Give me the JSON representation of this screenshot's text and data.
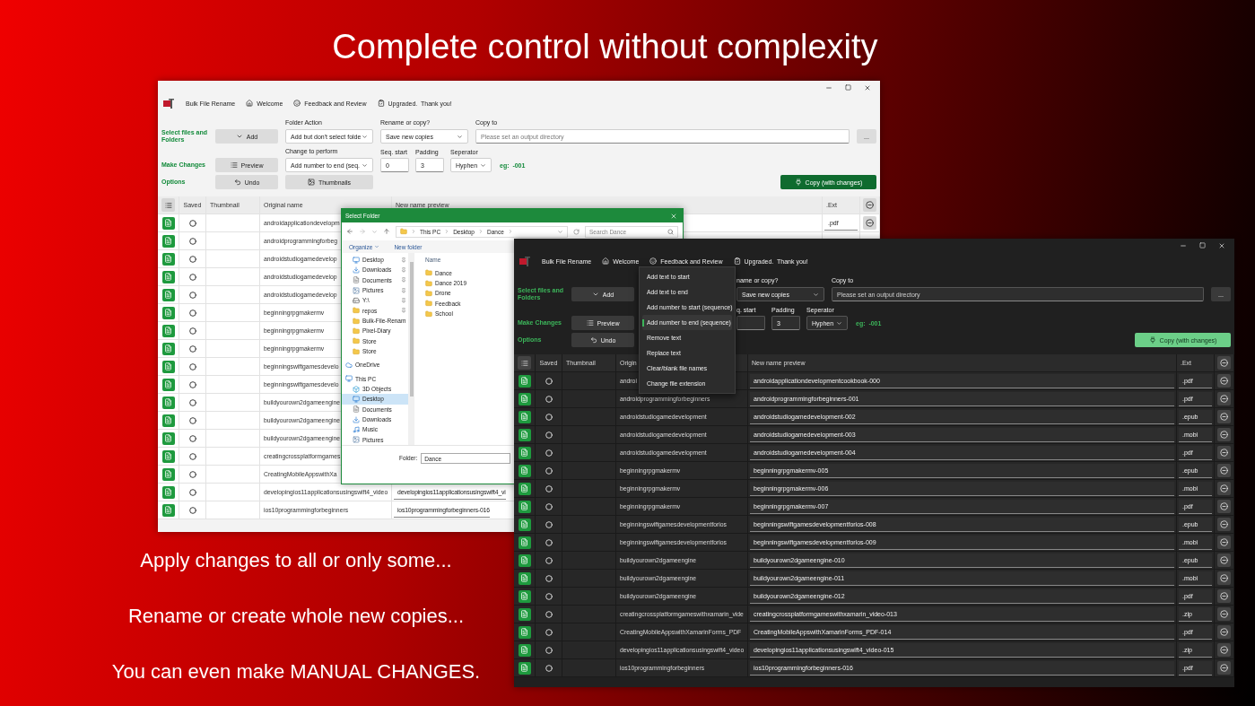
{
  "headline": "Complete control without complexity",
  "taglines": [
    "Apply changes to all or only some...",
    "Rename or create whole new copies...",
    "You can even make MANUAL CHANGES."
  ],
  "app_windows": [
    {
      "kind": "light",
      "nav": {
        "app_name": "Bulk File Rename",
        "links": [
          "Welcome",
          "Feedback and Review",
          "Upgraded.  Thank you!"
        ]
      },
      "section_labels": [
        "Select files and Folders",
        "Make Changes",
        "Options"
      ],
      "buttons": {
        "add": "Add",
        "preview": "Preview",
        "undo": "Undo",
        "thumbnails": "Thumbnails",
        "browse": "...",
        "copy": "Copy (with changes)"
      },
      "folder_action": {
        "label": "Folder Action",
        "value": "Add but don't select folde"
      },
      "change": {
        "label": "Change to perform",
        "value": "Add number to end (seq."
      },
      "rename_or_copy": {
        "label": "Rename or copy?",
        "value": "Save new copies"
      },
      "copy_to": {
        "label": "Copy to",
        "placeholder": "Please set an output directory"
      },
      "seq_start": {
        "label": "Seq. start",
        "value": "0"
      },
      "padding": {
        "label": "Padding",
        "value": "3"
      },
      "separator": {
        "label": "Seperator",
        "value": "Hyphen"
      },
      "example": "eg:  -001",
      "columns": [
        "Saved",
        "Thumbnail",
        "Original name",
        "New name preview",
        ".Ext"
      ],
      "rows": [
        {
          "original": "androidapplicationdevelopm",
          "ext": ".pdf"
        },
        {
          "original": "androidprogrammingforbeg"
        },
        {
          "original": "androidstudiogamedevelop"
        },
        {
          "original": "androidstudiogamedevelop"
        },
        {
          "original": "androidstudiogamedevelop"
        },
        {
          "original": "beginningrpgmakermv"
        },
        {
          "original": "beginningrpgmakermv"
        },
        {
          "original": "beginningrpgmakermv"
        },
        {
          "original": "beginningswiftgamesdevelo"
        },
        {
          "original": "beginningswiftgamesdevelo"
        },
        {
          "original": "buildyourown2dgameengine"
        },
        {
          "original": "buildyourown2dgameengine"
        },
        {
          "original": "buildyourown2dgameengine"
        },
        {
          "original": "creatingcrossplatformgames"
        },
        {
          "original": "CreatingMobileAppswithXa"
        },
        {
          "original": "developingios11applicationsusingswift4_video",
          "new_name": "developingios11applicationsusingswift4_vi"
        },
        {
          "original": "ios10programmingforbeginners",
          "new_name": "ios10programmingforbeginners-016"
        }
      ]
    },
    {
      "kind": "dark",
      "nav": {
        "app_name": "Bulk File Rename",
        "links": [
          "Welcome",
          "Feedback and Review",
          "Upgraded.  Thank you!"
        ]
      },
      "section_labels": [
        "Select files and Folders",
        "Make Changes",
        "Options"
      ],
      "buttons": {
        "add": "Add",
        "preview": "Preview",
        "undo": "Undo",
        "browse": "...",
        "copy": "Copy (with changes)"
      },
      "rename_or_copy": {
        "label": "name or copy?",
        "value": "Save new copies"
      },
      "copy_to": {
        "label": "Copy to",
        "placeholder": "Please set an output directory"
      },
      "seq_start": {
        "label": "q. start"
      },
      "padding": {
        "label": "Padding",
        "value": "3"
      },
      "separator": {
        "label": "Seperator",
        "value": "Hyphen"
      },
      "example": "eg:  -001",
      "menu": {
        "items": [
          {
            "label": "Add text to start",
            "selected": false
          },
          {
            "label": "Add text to end",
            "selected": false
          },
          {
            "label": "Add number to start (sequence)",
            "selected": false
          },
          {
            "label": "Add number to end (sequence)",
            "selected": true
          },
          {
            "label": "Remove text",
            "selected": false
          },
          {
            "label": "Replace text",
            "selected": false
          },
          {
            "label": "Clear/blank file names",
            "selected": false
          },
          {
            "label": "Change file extension",
            "selected": false
          }
        ]
      },
      "columns": [
        "Saved",
        "Thumbnail",
        "Origin",
        "New name preview",
        ".Ext"
      ],
      "rows": [
        {
          "original": "androi",
          "new_name": "androidapplicationdevelopmentcookbook-000",
          "ext": ".pdf"
        },
        {
          "original": "androidprogrammingforbeginners",
          "new_name": "androidprogrammingforbeginners-001",
          "ext": ".pdf"
        },
        {
          "original": "androidstudiogamedevelopment",
          "new_name": "androidstudiogamedevelopment-002",
          "ext": ".epub"
        },
        {
          "original": "androidstudiogamedevelopment",
          "new_name": "androidstudiogamedevelopment-003",
          "ext": ".mobi"
        },
        {
          "original": "androidstudiogamedevelopment",
          "new_name": "androidstudiogamedevelopment-004",
          "ext": ".pdf"
        },
        {
          "original": "beginningrpgmakermv",
          "new_name": "beginningrpgmakermv-005",
          "ext": ".epub"
        },
        {
          "original": "beginningrpgmakermv",
          "new_name": "beginningrpgmakermv-006",
          "ext": ".mobi"
        },
        {
          "original": "beginningrpgmakermv",
          "new_name": "beginningrpgmakermv-007",
          "ext": ".pdf"
        },
        {
          "original": "beginningswiftgamesdevelopmentforios",
          "new_name": "beginningswiftgamesdevelopmentforios-008",
          "ext": ".epub"
        },
        {
          "original": "beginningswiftgamesdevelopmentforios",
          "new_name": "beginningswiftgamesdevelopmentforios-009",
          "ext": ".mobi"
        },
        {
          "original": "buildyourown2dgameengine",
          "new_name": "buildyourown2dgameengine-010",
          "ext": ".epub"
        },
        {
          "original": "buildyourown2dgameengine",
          "new_name": "buildyourown2dgameengine-011",
          "ext": ".mobi"
        },
        {
          "original": "buildyourown2dgameengine",
          "new_name": "buildyourown2dgameengine-012",
          "ext": ".pdf"
        },
        {
          "original": "creatingcrossplatformgameswithxamarin_vide",
          "new_name": "creatingcrossplatformgameswithxamarin_video-013",
          "ext": ".zip"
        },
        {
          "original": "CreatingMobileAppswithXamarinForms_PDF",
          "new_name": "CreatingMobileAppswithXamarinForms_PDF-014",
          "ext": ".pdf"
        },
        {
          "original": "developingios11applicationsusingswift4_video",
          "new_name": "developingios11applicationsusingswift4_video-015",
          "ext": ".zip"
        },
        {
          "original": "ios10programmingforbeginners",
          "new_name": "ios10programmingforbeginners-016",
          "ext": ".pdf"
        }
      ]
    }
  ],
  "dialog": {
    "title": "Select Folder",
    "path": [
      "This PC",
      "Desktop",
      "Dance"
    ],
    "search_placeholder": "Search Dance",
    "toolbar": [
      "Organize",
      "New folder"
    ],
    "quick_access": [
      {
        "label": "Desktop",
        "kind": "desktop",
        "pinned": true,
        "selected": false
      },
      {
        "label": "Downloads",
        "kind": "downloads",
        "pinned": true,
        "selected": false
      },
      {
        "label": "Documents",
        "kind": "documents",
        "pinned": true,
        "selected": false
      },
      {
        "label": "Pictures",
        "kind": "pictures",
        "pinned": true,
        "selected": false
      },
      {
        "label": "Y:\\",
        "kind": "drive",
        "pinned": true,
        "selected": false
      },
      {
        "label": "repos",
        "kind": "folder",
        "pinned": true,
        "selected": false
      },
      {
        "label": "Bulk-File-Renam",
        "kind": "folder",
        "pinned": false,
        "selected": false
      },
      {
        "label": "Pixel-Diary",
        "kind": "folder",
        "pinned": false,
        "selected": false
      },
      {
        "label": "Store",
        "kind": "folder",
        "pinned": false,
        "selected": false
      },
      {
        "label": "Store",
        "kind": "folder",
        "pinned": false,
        "selected": false
      }
    ],
    "nav_roots": [
      {
        "label": "OneDrive",
        "kind": "cloud",
        "selected": false
      },
      {
        "label": "This PC",
        "kind": "pc",
        "selected": false,
        "children": [
          {
            "label": "3D Objects",
            "kind": "objects",
            "selected": false
          },
          {
            "label": "Desktop",
            "kind": "desktop",
            "selected": true
          },
          {
            "label": "Documents",
            "kind": "documents",
            "selected": false
          },
          {
            "label": "Downloads",
            "kind": "downloads",
            "selected": false
          },
          {
            "label": "Music",
            "kind": "music",
            "selected": false
          },
          {
            "label": "Pictures",
            "kind": "pictures",
            "selected": false
          }
        ]
      }
    ],
    "column": "Name",
    "folders": [
      "Dance",
      "Dance 2019",
      "Drone",
      "Feedback",
      "School"
    ],
    "folder_label": "Folder:",
    "folder_value": "Dance"
  }
}
